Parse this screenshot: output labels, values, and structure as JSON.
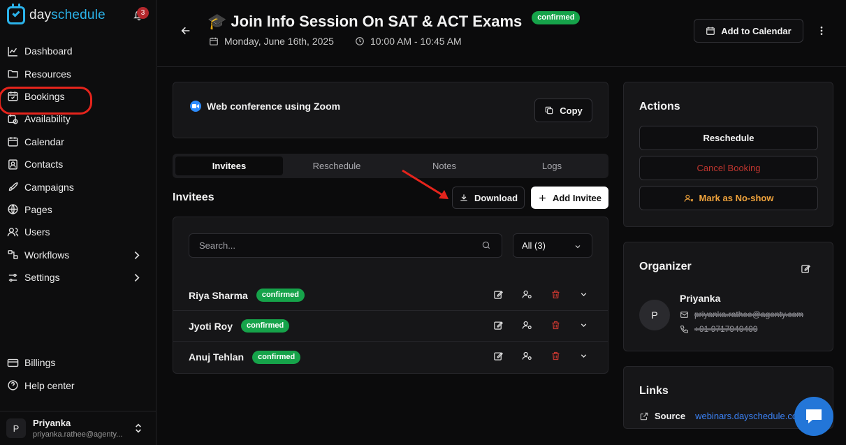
{
  "brand": {
    "name_part1": "day",
    "name_part2": "schedule",
    "color": "#2bb3ea"
  },
  "notifications": {
    "count": "3"
  },
  "sidebar": {
    "items": [
      {
        "label": "Dashboard",
        "icon": "chart-line-icon"
      },
      {
        "label": "Resources",
        "icon": "folder-icon"
      },
      {
        "label": "Bookings",
        "icon": "calendar-check-icon"
      },
      {
        "label": "Availability",
        "icon": "calendar-clock-icon"
      },
      {
        "label": "Calendar",
        "icon": "calendar-icon"
      },
      {
        "label": "Contacts",
        "icon": "contact-card-icon"
      },
      {
        "label": "Campaigns",
        "icon": "rocket-icon"
      },
      {
        "label": "Pages",
        "icon": "globe-icon"
      },
      {
        "label": "Users",
        "icon": "users-icon"
      },
      {
        "label": "Workflows",
        "icon": "workflow-icon"
      },
      {
        "label": "Settings",
        "icon": "sliders-icon"
      }
    ],
    "bottom": [
      {
        "label": "Billings",
        "icon": "credit-card-icon"
      },
      {
        "label": "Help center",
        "icon": "help-circle-icon"
      }
    ],
    "user": {
      "initial": "P",
      "name": "Priyanka",
      "email": "priyanka.rathee@agenty..."
    }
  },
  "event": {
    "title": "Join Info Session On SAT & ACT Exams",
    "emoji": "🎓",
    "status": "confirmed",
    "date": "Monday, June 16th, 2025",
    "time": "10:00 AM - 10:45 AM",
    "add_to_calendar": "Add to Calendar"
  },
  "conference": {
    "text": "Web conference using Zoom",
    "copy": "Copy"
  },
  "tabs": [
    "Invitees",
    "Reschedule",
    "Notes",
    "Logs"
  ],
  "invitees": {
    "title": "Invitees",
    "download": "Download",
    "add": "Add Invitee",
    "search_placeholder": "Search...",
    "filter": "All (3)",
    "rows": [
      {
        "name": "Riya Sharma",
        "status": "confirmed"
      },
      {
        "name": "Jyoti Roy",
        "status": "confirmed"
      },
      {
        "name": "Anuj Tehlan",
        "status": "confirmed"
      }
    ]
  },
  "actions": {
    "title": "Actions",
    "reschedule": "Reschedule",
    "cancel": "Cancel Booking",
    "no_show": "Mark as No-show"
  },
  "organizer": {
    "title": "Organizer",
    "initial": "P",
    "name": "Priyanka",
    "email": "priyanka.rathee@agenty.com",
    "phone": "+91 9717940400"
  },
  "links": {
    "title": "Links",
    "source_label": "Source",
    "source_url": "webinars.dayschedule.com"
  },
  "colors": {
    "confirmed": "#16a34a",
    "cancel": "#c2362f",
    "no_show": "#f0a33c",
    "link": "#3b82f6",
    "annotation": "#e5241c"
  }
}
